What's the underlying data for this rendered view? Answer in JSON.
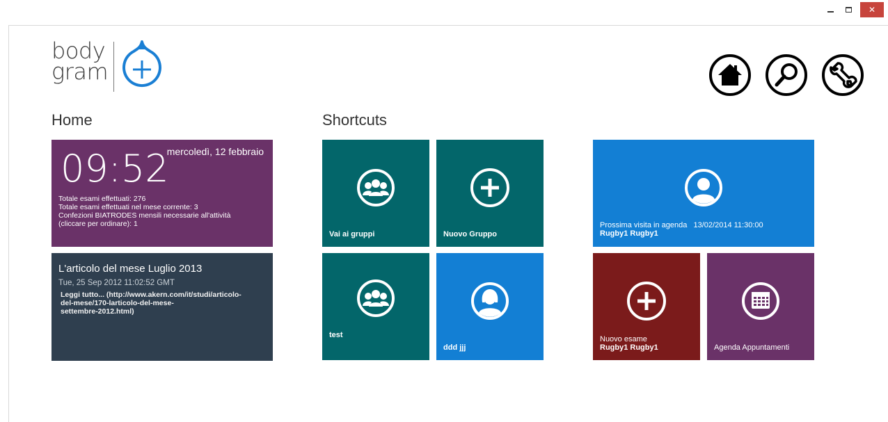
{
  "window": {
    "minimize_icon": "minimize-icon",
    "maximize_icon": "maximize-icon",
    "close_glyph": "✕"
  },
  "logo": {
    "line1": "body",
    "line2": "gram",
    "mark_icon": "plus-drop-icon",
    "accent": "#1a7fd4"
  },
  "nav": {
    "home_icon": "home-icon",
    "search_icon": "search-icon",
    "settings_icon": "wrench-icon"
  },
  "home": {
    "title": "Home",
    "clock": {
      "time": "09:52",
      "date": "mercoledì, 12 febbraio",
      "stats": [
        "Totale esami effettuati: 276",
        "Totale esami effettuati nel mese corrente: 3",
        "Confezioni BIATRODES mensili necessarie all'attività",
        "(cliccare per ordinare): 1"
      ],
      "color": "#6a3268"
    },
    "article": {
      "title": "L'articolo del mese Luglio 2013",
      "date": "Tue, 25 Sep 2012 11:02:52 GMT",
      "link_lines": [
        " Leggi tutto... (http://www.akern.com/it/studi/articolo-",
        "del-mese/170-larticolo-del-mese-",
        "settembre-2012.html)"
      ],
      "color": "#2f3f4f"
    }
  },
  "shortcuts": {
    "title": "Shortcuts",
    "groups": {
      "label": "Vai ai gruppi",
      "icon": "group-icon"
    },
    "new_group": {
      "label": "Nuovo Gruppo",
      "icon": "plus-circle-icon"
    },
    "test": {
      "label": "test",
      "icon": "group-icon"
    },
    "ddd": {
      "label": "ddd  jjj",
      "icon": "female-user-icon"
    },
    "visit": {
      "label_prefix": "Prossima visita in agenda",
      "datetime": "13/02/2014 11:30:00",
      "patient": "Rugby1  Rugby1",
      "icon": "user-icon"
    },
    "new_exam": {
      "label": "Nuovo esame",
      "patient": "Rugby1  Rugby1",
      "icon": "plus-circle-icon"
    },
    "agenda": {
      "label": "Agenda Appuntamenti",
      "icon": "calendar-icon"
    },
    "colors": {
      "teal": "#03666a",
      "blue": "#137fd4",
      "red": "#7b1b1b",
      "purple": "#6a3268"
    }
  }
}
